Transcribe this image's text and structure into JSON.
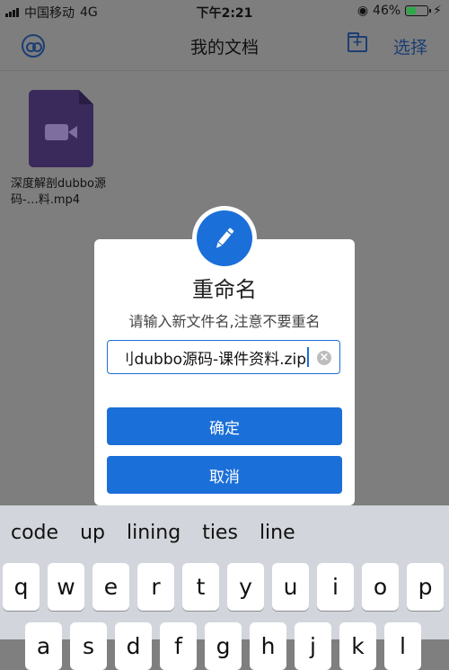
{
  "status_bar": {
    "carrier": "中国移动",
    "network": "4G",
    "time": "下午2:21",
    "battery": "46%",
    "battery_level": 0.46
  },
  "nav": {
    "title": "我的文档",
    "select_label": "选择"
  },
  "files": [
    {
      "name": "深度解剖dubbo源码-…料.mp4",
      "icon": "video-file-icon"
    }
  ],
  "dialog": {
    "title": "重命名",
    "subtitle": "请输入新文件名,注意不要重名",
    "input_value": "刂dubbo源码-课件资料.zip",
    "confirm_label": "确定",
    "cancel_label": "取消"
  },
  "keyboard": {
    "suggestions": [
      "code",
      "up",
      "lining",
      "ties",
      "line"
    ],
    "row1": [
      "q",
      "w",
      "e",
      "r",
      "t",
      "y",
      "u",
      "i",
      "o",
      "p"
    ],
    "row2": [
      "a",
      "s",
      "d",
      "f",
      "g",
      "h",
      "j",
      "k",
      "l"
    ]
  },
  "colors": {
    "accent": "#1b6fd8",
    "dim_background": "#7e7e7e",
    "file_icon": "#3a2a5b"
  }
}
